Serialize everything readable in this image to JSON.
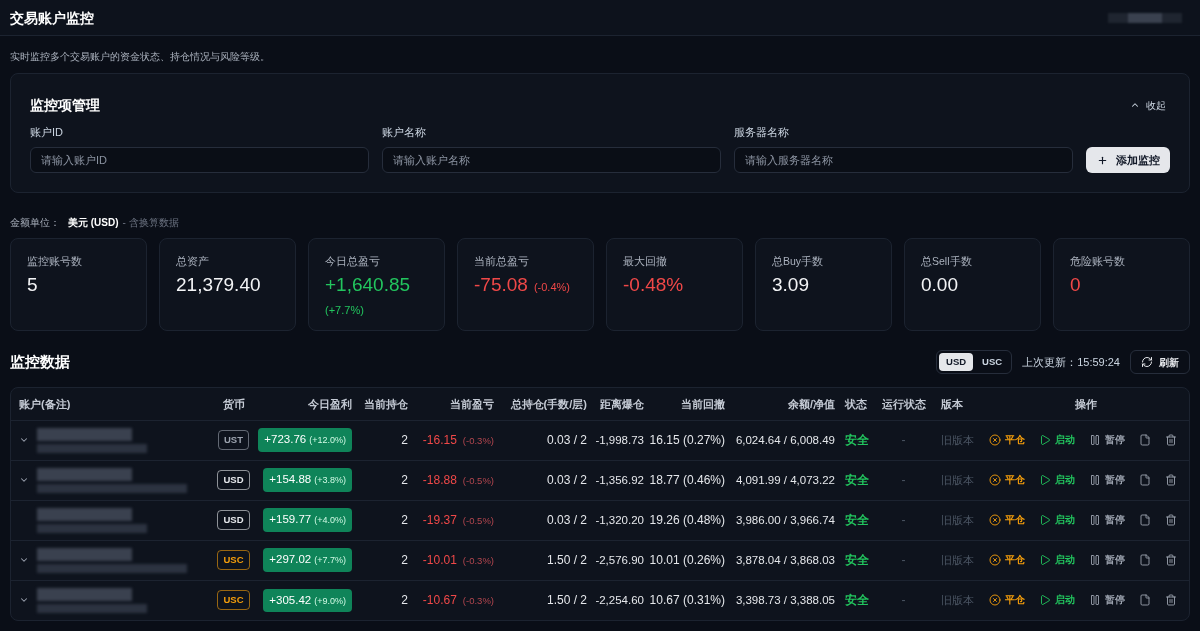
{
  "header": {
    "title": "交易账户监控"
  },
  "subtitle": "实时监控多个交易账户的资金状态、持仓情况与风险等级。",
  "monitor_manager": {
    "title": "监控项管理",
    "collapse_label": "收起",
    "fields": [
      {
        "label": "账户ID",
        "placeholder": "请输入账户ID"
      },
      {
        "label": "账户名称",
        "placeholder": "请输入账户名称"
      },
      {
        "label": "服务器名称",
        "placeholder": "请输入服务器名称"
      }
    ],
    "add_button": "添加监控"
  },
  "currency_unit": {
    "label": "金额单位：",
    "value": "美元 (USD)",
    "note": "- 含换算数据"
  },
  "stats": [
    {
      "label": "监控账号数",
      "value": "5",
      "kind": "neutral"
    },
    {
      "label": "总资产",
      "value": "21,379.40",
      "kind": "neutral"
    },
    {
      "label": "今日总盈亏",
      "value": "+1,640.85",
      "change": "(+7.7%)",
      "kind": "positive"
    },
    {
      "label": "当前总盈亏",
      "value": "-75.08",
      "change": "(-0.4%)",
      "kind": "negative"
    },
    {
      "label": "最大回撤",
      "value": "-0.48%",
      "kind": "negative"
    },
    {
      "label": "总Buy手数",
      "value": "3.09",
      "kind": "neutral"
    },
    {
      "label": "总Sell手数",
      "value": "0.00",
      "kind": "neutral"
    },
    {
      "label": "危险账号数",
      "value": "0",
      "kind": "negative"
    }
  ],
  "monitor_data": {
    "title": "监控数据",
    "currency_toggle": [
      {
        "label": "USD",
        "selected": true
      },
      {
        "label": "USC",
        "selected": false
      }
    ],
    "last_update": "上次更新：15:59:24",
    "refresh_button": "刷新",
    "table": {
      "columns": [
        "账户(备注)",
        "货币",
        "今日盈利",
        "当前持仓",
        "当前盈亏",
        "总持仓(手数/层)",
        "距离爆仓",
        "当前回撤",
        "余额/净值",
        "状态",
        "运行状态",
        "版本",
        "操作"
      ],
      "rows": [
        {
          "expandable": true,
          "currency": {
            "label": "UST",
            "color": "#9ca3af"
          },
          "today_profit": {
            "value": "+723.76",
            "percent": "(+12.0%)"
          },
          "positions": "2",
          "current_pnl": {
            "value": "-16.15",
            "percent": "(-0.3%)"
          },
          "total_position": "0.03 / 2",
          "distance_to_liquidation": "-1,998.73",
          "drawdown": "16.15 (0.27%)",
          "balance_equity": "6,024.64 / 6,008.49",
          "status": {
            "label": "安全",
            "kind": "safe"
          },
          "run_status": "-",
          "version": "旧版本",
          "actions": [
            {
              "kind": "close",
              "label": "平仓"
            },
            {
              "kind": "start",
              "label": "启动"
            },
            {
              "kind": "pause",
              "label": "暂停"
            },
            {
              "kind": "details"
            },
            {
              "kind": "delete"
            }
          ]
        },
        {
          "expandable": true,
          "currency": {
            "label": "USD",
            "color": "#e5e7eb"
          },
          "today_profit": {
            "value": "+154.88",
            "percent": "(+3.8%)"
          },
          "positions": "2",
          "current_pnl": {
            "value": "-18.88",
            "percent": "(-0.5%)"
          },
          "total_position": "0.03 / 2",
          "distance_to_liquidation": "-1,356.92",
          "drawdown": "18.77 (0.46%)",
          "balance_equity": "4,091.99 / 4,073.22",
          "status": {
            "label": "安全",
            "kind": "safe"
          },
          "run_status": "-",
          "version": "旧版本",
          "actions": [
            {
              "kind": "close",
              "label": "平仓"
            },
            {
              "kind": "start",
              "label": "启动"
            },
            {
              "kind": "pause",
              "label": "暂停"
            },
            {
              "kind": "details"
            },
            {
              "kind": "delete"
            }
          ]
        },
        {
          "expandable": false,
          "currency": {
            "label": "USD",
            "color": "#e5e7eb"
          },
          "today_profit": {
            "value": "+159.77",
            "percent": "(+4.0%)"
          },
          "positions": "2",
          "current_pnl": {
            "value": "-19.37",
            "percent": "(-0.5%)"
          },
          "total_position": "0.03 / 2",
          "distance_to_liquidation": "-1,320.20",
          "drawdown": "19.26 (0.48%)",
          "balance_equity": "3,986.00 / 3,966.74",
          "status": {
            "label": "安全",
            "kind": "safe"
          },
          "run_status": "-",
          "version": "旧版本",
          "actions": [
            {
              "kind": "close",
              "label": "平仓"
            },
            {
              "kind": "start",
              "label": "启动"
            },
            {
              "kind": "pause",
              "label": "暂停"
            },
            {
              "kind": "details"
            },
            {
              "kind": "delete"
            }
          ]
        },
        {
          "expandable": true,
          "currency": {
            "label": "USC",
            "color": "#f59e0b"
          },
          "today_profit": {
            "value": "+297.02",
            "percent": "(+7.7%)"
          },
          "positions": "2",
          "current_pnl": {
            "value": "-10.01",
            "percent": "(-0.3%)"
          },
          "total_position": "1.50 / 2",
          "distance_to_liquidation": "-2,576.90",
          "drawdown": "10.01 (0.26%)",
          "balance_equity": "3,878.04 / 3,868.03",
          "status": {
            "label": "安全",
            "kind": "safe"
          },
          "run_status": "-",
          "version": "旧版本",
          "actions": [
            {
              "kind": "close",
              "label": "平仓"
            },
            {
              "kind": "start",
              "label": "启动"
            },
            {
              "kind": "pause",
              "label": "暂停"
            },
            {
              "kind": "details"
            },
            {
              "kind": "delete"
            }
          ]
        },
        {
          "expandable": true,
          "currency": {
            "label": "USC",
            "color": "#f59e0b"
          },
          "today_profit": {
            "value": "+305.42",
            "percent": "(+9.0%)"
          },
          "positions": "2",
          "current_pnl": {
            "value": "-10.67",
            "percent": "(-0.3%)"
          },
          "total_position": "1.50 / 2",
          "distance_to_liquidation": "-2,254.60",
          "drawdown": "10.67 (0.31%)",
          "balance_equity": "3,398.73 / 3,388.05",
          "status": {
            "label": "安全",
            "kind": "safe"
          },
          "run_status": "-",
          "version": "旧版本",
          "actions": [
            {
              "kind": "close",
              "label": "平仓"
            },
            {
              "kind": "start",
              "label": "启动"
            },
            {
              "kind": "pause",
              "label": "暂停"
            },
            {
              "kind": "details"
            },
            {
              "kind": "delete"
            }
          ]
        }
      ]
    }
  }
}
